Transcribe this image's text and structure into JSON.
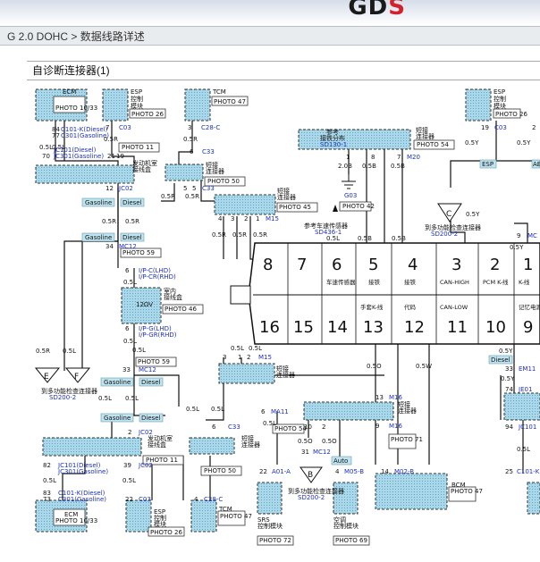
{
  "header": {
    "logo_main": "GD",
    "logo_accent": "S",
    "breadcrumb": "G 2.0 DOHC > 数据线路详述"
  },
  "diagram": {
    "title": "自诊断连接器(1)",
    "components": {
      "ecm_top": {
        "name": "ECM",
        "photo": "PHOTO 10/33"
      },
      "esp_top": {
        "name1": "ESP",
        "name2": "控制",
        "name3": "模块",
        "photo": "PHOTO 26"
      },
      "tcm_top": {
        "name": "TCM",
        "photo": "PHOTO 47"
      },
      "esp_right": {
        "name1": "ESP",
        "name2": "控制",
        "name3": "模块",
        "photo": "PHOTO 26"
      },
      "engine_box_top": {
        "name1": "发动机室",
        "name2": "接线盒"
      },
      "short_connector_1": {
        "name1": "短接",
        "name2": "连接器",
        "photo": "PHOTO 50"
      },
      "short_connector_2": {
        "name1": "短接",
        "name2": "连接器",
        "photo": "PHOTO 45"
      },
      "short_connector_3": {
        "name1": "短接",
        "name2": "连接器",
        "photo": "PHOTO 54"
      },
      "ref_distribution": {
        "name1": "参考",
        "name2": "接铁分布",
        "ref": "SD130-1"
      },
      "g03": {
        "label": "G03",
        "photo": "PHOTO 42"
      },
      "ref_fuse": {
        "label": "参考车速传感器",
        "ref": "SD436-1"
      },
      "ref_multifunction_1": {
        "label": "到多功能检查连接器",
        "ref": "SD200-2"
      },
      "joint_block": {
        "name1": "室内",
        "name2": "接线盒",
        "photo": "PHOTO 46",
        "label": "12ΩV"
      },
      "dlc": {
        "top_pins": [
          "8",
          "7",
          "6",
          "5",
          "4",
          "3",
          "2",
          "1"
        ],
        "bottom_pins": [
          "16",
          "15",
          "14",
          "13",
          "12",
          "11",
          "10",
          "9"
        ],
        "top_labels": [
          "",
          "",
          "车速传感器",
          "接铁",
          "接铁",
          "CAN-HIGH",
          "PCM K-线",
          "K-线"
        ],
        "bottom_labels": [
          "",
          "",
          "",
          "手套K-线",
          "代码",
          "CAN-LOW",
          "",
          "记忆电源"
        ]
      },
      "ref_multifunction_left": {
        "label": "到多功能检查连接器",
        "ref": "SD200-2"
      },
      "short_connector_bottom_1": {
        "name1": "短接",
        "name2": "连接器"
      },
      "short_connector_bottom_2": {
        "name1": "短接",
        "name2": "连接器",
        "photo": "PHOTO 71"
      },
      "engine_box_bottom": {
        "name1": "发动机室",
        "name2": "接线盒",
        "photo": "PHOTO 11"
      },
      "short_connector_bottom_3": {
        "name1": "短接",
        "name2": "连接器",
        "photo": "PHOTO 50"
      },
      "ecm_bottom": {
        "name": "ECM",
        "photo": "PHOTO 10/33"
      },
      "esp_bottom": {
        "name1": "ESP",
        "name2": "控制",
        "name3": "模块",
        "photo": "PHOTO 26"
      },
      "tcm_bottom": {
        "name": "TCM",
        "photo": "PHOTO 47"
      },
      "srs": {
        "name1": "SRS",
        "name2": "控制模块",
        "photo": "PHOTO 72"
      },
      "aircon": {
        "name1": "空调",
        "name2": "控制模块",
        "photo": "PHOTO 69"
      },
      "bcm": {
        "name": "BCM",
        "photo": "PHOTO 47"
      },
      "ref_multifunction_2": {
        "label": "到多功能检查连接器",
        "ref": "SD200-2"
      }
    },
    "labels": {
      "c101k_diesel": "C101-K(Diesel)",
      "c301_gasoline": "C301(Gasoline)",
      "jc101_diesel": "JC101(Diesel)",
      "jc301_gasoline": "JC301(Gasoline)",
      "c03": "C03",
      "c28c": "C28-C",
      "c33": "C33",
      "jc02": "JC02",
      "gasoline": "Gasoline",
      "diesel": "Diesel",
      "mc12": "MC12",
      "m15": "M15",
      "m20": "M20",
      "ipc_lhd": "I/P-C(LHD)",
      "ipcr_rhd": "I/P-CR(RHD)",
      "ipg_lhd": "I/P-G(LHD)",
      "ipgr_rhd": "I/P-GR(RHD)",
      "m16": "M16",
      "ma11": "MA11",
      "a01a": "A01-A",
      "m05b": "M05-B",
      "m02b": "M02-B",
      "c101k": "C101-K",
      "em11": "EM11",
      "je01": "JE01",
      "jc101": "JC101",
      "ab": "AB",
      "mc": "MC",
      "esp": "ESP",
      "auto": "Auto",
      "photo11": "PHOTO 11",
      "photo59": "PHOTO 59",
      "photo54": "PHOTO 54",
      "e_label": "E",
      "f_label": "F",
      "b_label": "B",
      "c_label": "C",
      "wire_05r": "0.5R",
      "wire_05l": "0.5L",
      "wire_05y": "0.5Y",
      "wire_05b": "0.5B",
      "wire_05o": "0.5O",
      "wire_05w": "0.5W",
      "wire_20b": "2.0B",
      "pin_84": "84",
      "pin_77": "77",
      "pin_70": "70",
      "pin_21": "21",
      "pin_19": "19",
      "pin_12": "12",
      "pin_34": "34",
      "pin_6": "6",
      "pin_5": "5",
      "pin_4": "4",
      "pin_3": "3",
      "pin_2": "2",
      "pin_1": "1",
      "pin_7": "7",
      "pin_8": "8",
      "pin_9": "9",
      "pin_10": "10",
      "pin_11": "11",
      "pin_12b": "12",
      "pin_13": "13",
      "pin_14": "14",
      "pin_22": "22",
      "pin_25": "25",
      "pin_31": "31",
      "pin_32": "32",
      "pin_33": "33",
      "pin_39": "39",
      "pin_74": "74",
      "pin_73": "73",
      "pin_82": "82",
      "pin_83": "83",
      "pin_94": "94"
    }
  }
}
